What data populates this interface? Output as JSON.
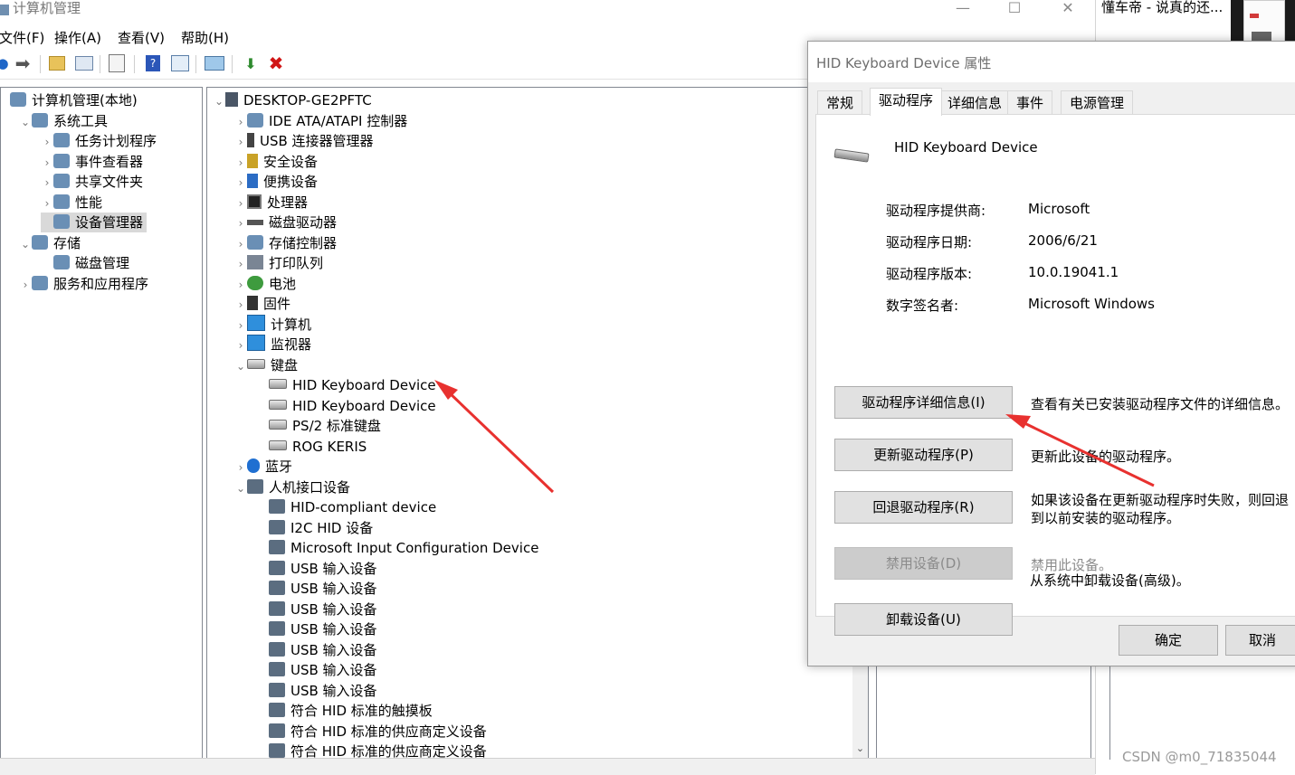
{
  "main_window": {
    "title": "计算机管理",
    "controls": {
      "minimize": "—",
      "maximize": "☐",
      "close": "✕"
    },
    "menu": [
      "文件(F)",
      "操作(A)",
      "查看(V)",
      "帮助(H)"
    ]
  },
  "left_tree": [
    {
      "label": "计算机管理(本地)",
      "indent": 0,
      "chev": "",
      "icon": "computer-management-icon"
    },
    {
      "label": "系统工具",
      "indent": 1,
      "chev": "⌄",
      "icon": "system-tools-icon"
    },
    {
      "label": "任务计划程序",
      "indent": 2,
      "chev": "›",
      "icon": "task-scheduler-icon"
    },
    {
      "label": "事件查看器",
      "indent": 2,
      "chev": "›",
      "icon": "event-viewer-icon"
    },
    {
      "label": "共享文件夹",
      "indent": 2,
      "chev": "›",
      "icon": "shared-folders-icon"
    },
    {
      "label": "性能",
      "indent": 2,
      "chev": "›",
      "icon": "performance-icon"
    },
    {
      "label": "设备管理器",
      "indent": 2,
      "chev": "",
      "icon": "device-manager-icon",
      "selected": true
    },
    {
      "label": "存储",
      "indent": 1,
      "chev": "⌄",
      "icon": "storage-icon"
    },
    {
      "label": "磁盘管理",
      "indent": 2,
      "chev": "",
      "icon": "disk-management-icon"
    },
    {
      "label": "服务和应用程序",
      "indent": 1,
      "chev": "›",
      "icon": "services-icon"
    }
  ],
  "device_tree": [
    {
      "label": "DESKTOP-GE2PFTC",
      "indent": 0,
      "chev": "⌄",
      "icon": "computer-icon"
    },
    {
      "label": "IDE ATA/ATAPI 控制器",
      "indent": 1,
      "chev": "›",
      "icon": "ide-controller-icon"
    },
    {
      "label": "USB 连接器管理器",
      "indent": 1,
      "chev": "›",
      "icon": "usb-connector-icon"
    },
    {
      "label": "安全设备",
      "indent": 1,
      "chev": "›",
      "icon": "security-device-icon"
    },
    {
      "label": "便携设备",
      "indent": 1,
      "chev": "›",
      "icon": "portable-device-icon"
    },
    {
      "label": "处理器",
      "indent": 1,
      "chev": "›",
      "icon": "processor-icon"
    },
    {
      "label": "磁盘驱动器",
      "indent": 1,
      "chev": "›",
      "icon": "disk-drive-icon"
    },
    {
      "label": "存储控制器",
      "indent": 1,
      "chev": "›",
      "icon": "storage-controller-icon"
    },
    {
      "label": "打印队列",
      "indent": 1,
      "chev": "›",
      "icon": "printer-icon"
    },
    {
      "label": "电池",
      "indent": 1,
      "chev": "›",
      "icon": "battery-icon"
    },
    {
      "label": "固件",
      "indent": 1,
      "chev": "›",
      "icon": "firmware-icon"
    },
    {
      "label": "计算机",
      "indent": 1,
      "chev": "›",
      "icon": "monitor-icon"
    },
    {
      "label": "监视器",
      "indent": 1,
      "chev": "›",
      "icon": "monitor-icon"
    },
    {
      "label": "键盘",
      "indent": 1,
      "chev": "⌄",
      "icon": "keyboard-icon"
    },
    {
      "label": "HID Keyboard Device",
      "indent": 2,
      "chev": "",
      "icon": "keyboard-icon"
    },
    {
      "label": "HID Keyboard Device",
      "indent": 2,
      "chev": "",
      "icon": "keyboard-icon"
    },
    {
      "label": "PS/2 标准键盘",
      "indent": 2,
      "chev": "",
      "icon": "keyboard-icon"
    },
    {
      "label": "ROG KERIS",
      "indent": 2,
      "chev": "",
      "icon": "keyboard-icon"
    },
    {
      "label": "蓝牙",
      "indent": 1,
      "chev": "›",
      "icon": "bluetooth-icon"
    },
    {
      "label": "人机接口设备",
      "indent": 1,
      "chev": "⌄",
      "icon": "hid-icon"
    },
    {
      "label": "HID-compliant device",
      "indent": 2,
      "chev": "",
      "icon": "hid-icon"
    },
    {
      "label": "I2C HID 设备",
      "indent": 2,
      "chev": "",
      "icon": "hid-icon"
    },
    {
      "label": "Microsoft Input Configuration Device",
      "indent": 2,
      "chev": "",
      "icon": "hid-icon"
    },
    {
      "label": "USB 输入设备",
      "indent": 2,
      "chev": "",
      "icon": "hid-icon"
    },
    {
      "label": "USB 输入设备",
      "indent": 2,
      "chev": "",
      "icon": "hid-icon"
    },
    {
      "label": "USB 输入设备",
      "indent": 2,
      "chev": "",
      "icon": "hid-icon"
    },
    {
      "label": "USB 输入设备",
      "indent": 2,
      "chev": "",
      "icon": "hid-icon"
    },
    {
      "label": "USB 输入设备",
      "indent": 2,
      "chev": "",
      "icon": "hid-icon"
    },
    {
      "label": "USB 输入设备",
      "indent": 2,
      "chev": "",
      "icon": "hid-icon"
    },
    {
      "label": "USB 输入设备",
      "indent": 2,
      "chev": "",
      "icon": "hid-icon"
    },
    {
      "label": "符合 HID 标准的触摸板",
      "indent": 2,
      "chev": "",
      "icon": "hid-icon"
    },
    {
      "label": "符合 HID 标准的供应商定义设备",
      "indent": 2,
      "chev": "",
      "icon": "hid-icon"
    },
    {
      "label": "符合 HID 标准的供应商定义设备",
      "indent": 2,
      "chev": "",
      "icon": "hid-icon"
    }
  ],
  "external_window": {
    "title": "懂车帝 - 说真的还..."
  },
  "dialog": {
    "title": "HID Keyboard Device 属性",
    "tabs": [
      "常规",
      "驱动程序",
      "详细信息",
      "事件",
      "电源管理"
    ],
    "active_tab": "驱动程序",
    "device_name": "HID Keyboard Device",
    "properties": [
      {
        "label": "驱动程序提供商:",
        "value": "Microsoft"
      },
      {
        "label": "驱动程序日期:",
        "value": "2006/6/21"
      },
      {
        "label": "驱动程序版本:",
        "value": "10.0.19041.1"
      },
      {
        "label": "数字签名者:",
        "value": "Microsoft Windows"
      }
    ],
    "actions": [
      {
        "button": "驱动程序详细信息(I)",
        "description": "查看有关已安装驱动程序文件的详细信息。",
        "disabled": false
      },
      {
        "button": "更新驱动程序(P)",
        "description": "更新此设备的驱动程序。",
        "disabled": false
      },
      {
        "button": "回退驱动程序(R)",
        "description": "如果该设备在更新驱动程序时失败，则回退到以前安装的驱动程序。",
        "disabled": false
      },
      {
        "button": "禁用设备(D)",
        "description": "禁用此设备。",
        "disabled": true
      },
      {
        "button": "卸载设备(U)",
        "description": "从系统中卸载设备(高级)。",
        "disabled": false
      }
    ],
    "ok_label": "确定",
    "cancel_label": "取消"
  },
  "watermark": "CSDN @m0_71835044",
  "colors": {
    "annotation_arrow": "#e8312f",
    "orange_button": "#f07c00",
    "selection": "#d9d9d9"
  }
}
